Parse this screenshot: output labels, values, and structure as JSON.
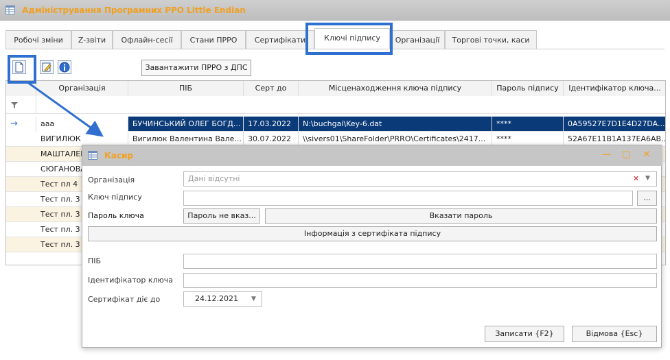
{
  "window": {
    "title": "Адміністрування Програмних РРО Little Endian"
  },
  "tabs": [
    {
      "label": "Робочі зміни"
    },
    {
      "label": "Z-звіти"
    },
    {
      "label": "Офлайн-сесії"
    },
    {
      "label": "Стани ПРРО"
    },
    {
      "label": "Сертифікати"
    },
    {
      "label": "Ключі підпису"
    },
    {
      "label": "Організації"
    },
    {
      "label": "Торгові точки, каси"
    }
  ],
  "toolbar": {
    "load_label": "Завантажити ПРРО з ДПС"
  },
  "grid": {
    "columns": [
      "Організація",
      "ПІБ",
      "Серт до",
      "Місценаходження ключа підпису",
      "Пароль підпису",
      "Ідентифікатор ключа..."
    ],
    "rows": [
      {
        "org": "ааа",
        "pib": "БУЧИНСЬКИЙ ОЛЕГ БОГД...",
        "cert": "17.03.2022",
        "location": "N:\\buchgai\\Key-6.dat",
        "password": "****",
        "id": "0A59527E7D1E4D27DA..."
      },
      {
        "org": "ВИГИЛЮК",
        "pib": "Вигилюк Валентина Вале...",
        "cert": "30.07.2022",
        "location": "\\\\sivers01\\ShareFolder\\PRRO\\Certificates\\2417...",
        "password": "****",
        "id": "52A67E11B1A137EA6AB..."
      },
      {
        "org": "МАШТАЛЕР"
      },
      {
        "org": "СЮГАНОВА"
      },
      {
        "org": "Тест пл 4"
      },
      {
        "org": "Тест пл. 3"
      },
      {
        "org": "Тест пл. 3"
      },
      {
        "org": "Тест пл. 3"
      },
      {
        "org": "Тест пл. 3"
      }
    ]
  },
  "dialog": {
    "title": "Касир",
    "org_label": "Організація",
    "org_value": "Дані відсутні",
    "key_label": "Ключ підпису",
    "browse_label": "...",
    "pwd_label": "Пароль ключа",
    "pwd_state": "Пароль не вказ...",
    "set_pwd": "Вказати пароль",
    "cert_info": "Інформація з сертифіката підпису",
    "pib_label": "ПІБ",
    "keyid_label": "Ідентифікатор ключа",
    "valid_label": "Сертифікат діє до",
    "valid_value": "24.12.2021",
    "save": "Записати {F2}",
    "cancel": "Відмова {Esc}"
  },
  "colors": {
    "highlight": "#2f6fd0",
    "accent": "#f0a020",
    "selected_row": "#0b3a78"
  }
}
